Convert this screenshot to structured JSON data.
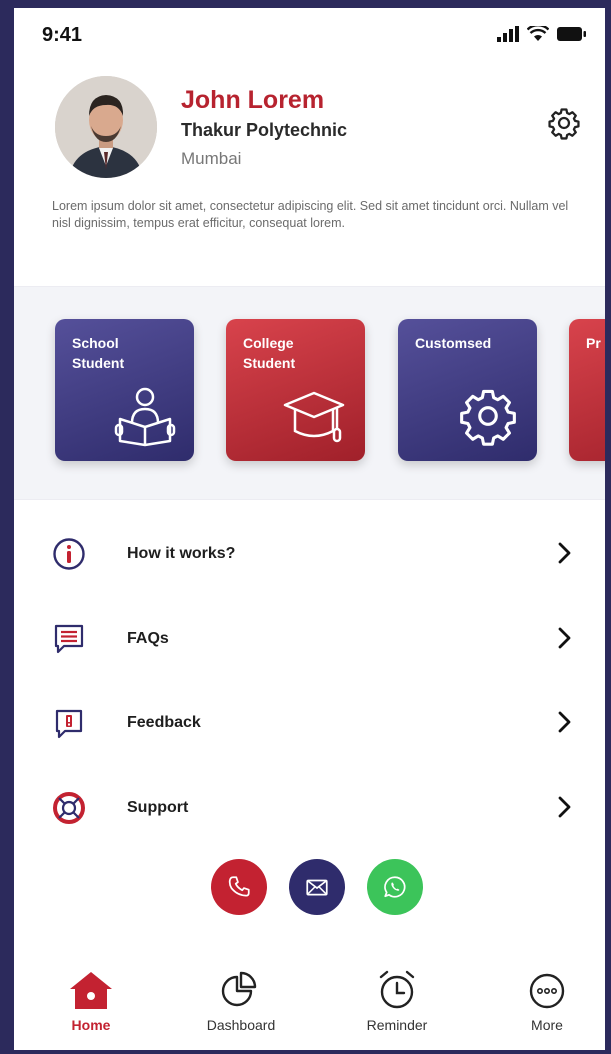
{
  "status_bar": {
    "time": "9:41"
  },
  "profile": {
    "name": "John Lorem",
    "college": "Thakur Polytechnic",
    "city": "Mumbai",
    "bio": "Lorem ipsum dolor sit amet, consectetur adipiscing elit. Sed sit amet tincidunt orci. Nullam vel nisl dignissim, tempus erat efficitur, consequat lorem."
  },
  "cards": [
    {
      "label": "School\nStudent",
      "icon": "reading-student-icon",
      "color": "#3f3b80"
    },
    {
      "label": "College\nStudent",
      "icon": "graduation-cap-icon",
      "color": "#c32231"
    },
    {
      "label": "Customsed",
      "icon": "gear-icon",
      "color": "#3f3b80"
    },
    {
      "label": "Pr",
      "icon": "",
      "color": "#c32231"
    }
  ],
  "menu": [
    {
      "label": "How it works?",
      "icon": "info-icon"
    },
    {
      "label": "FAQs",
      "icon": "chat-list-icon"
    },
    {
      "label": "Feedback",
      "icon": "feedback-icon"
    },
    {
      "label": "Support",
      "icon": "lifebuoy-icon"
    }
  ],
  "contacts": [
    {
      "name": "phone",
      "icon": "phone-icon",
      "color": "#c32231"
    },
    {
      "name": "mail",
      "icon": "mail-icon",
      "color": "#2f2c6c"
    },
    {
      "name": "whatsapp",
      "icon": "whatsapp-icon",
      "color": "#3cc45a"
    }
  ],
  "nav": {
    "home": "Home",
    "dashboard": "Dashboard",
    "reminder": "Reminder",
    "more": "More"
  },
  "colors": {
    "accent": "#c32231",
    "primary": "#2f2c6c",
    "frame": "#2c2a5c"
  }
}
